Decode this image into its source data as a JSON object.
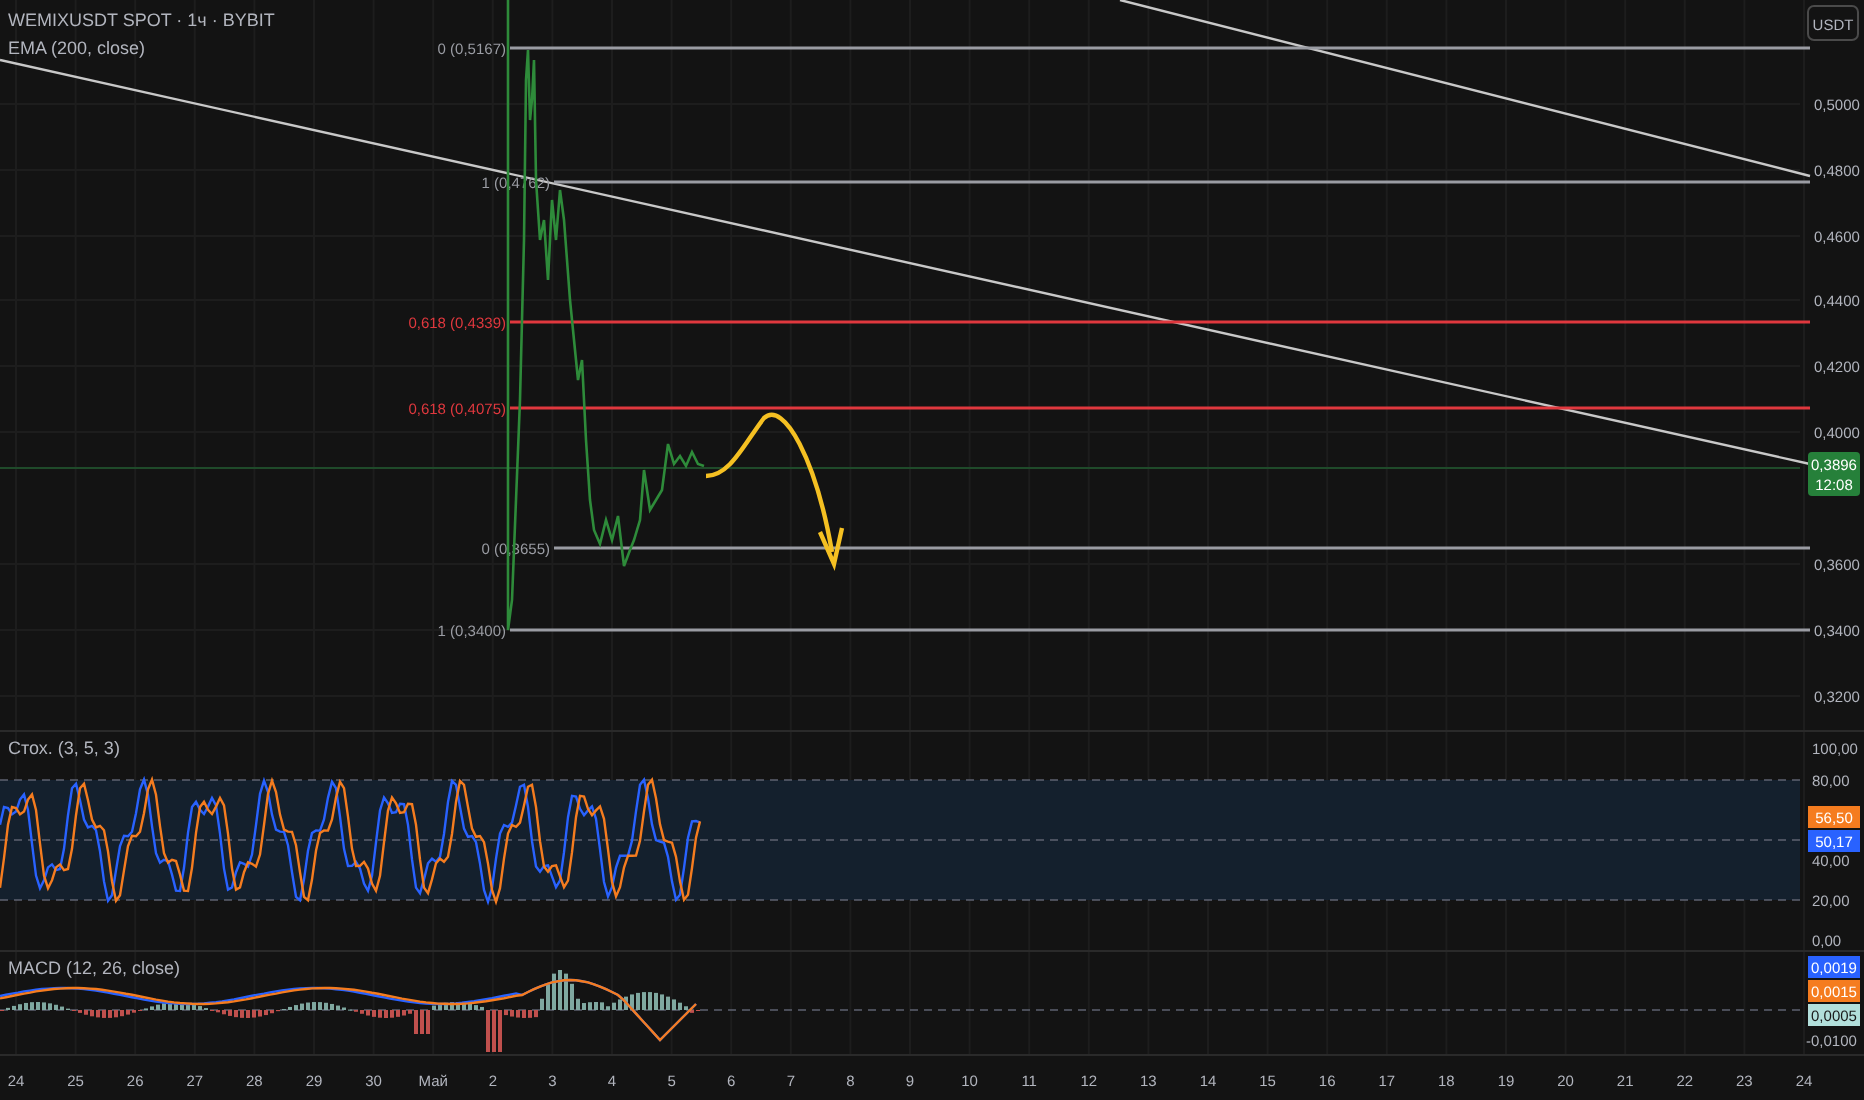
{
  "header": {
    "symbol": "WEMIXUSDT SPOT · 1ч · BYBIT",
    "indicator": "EMA (200, close)"
  },
  "price_axis": {
    "currency": "USDT",
    "ticks": [
      "0,5000",
      "0,4800",
      "0,4600",
      "0,4400",
      "0,4200",
      "0,4000",
      "0,3600",
      "0,3400",
      "0,3200"
    ],
    "last_price": {
      "value": "0,3896",
      "countdown": "12:08"
    }
  },
  "fib_levels": [
    {
      "label": "0 (0,5167)",
      "color": "#9a9ca3"
    },
    {
      "label": "1 (0,4762)",
      "color": "#9a9ca3"
    },
    {
      "label": "0,618 (0,4339)",
      "color": "#e0383e"
    },
    {
      "label": "0,618 (0,4075)",
      "color": "#e0383e"
    },
    {
      "label": "0 (0,3655)",
      "color": "#9a9ca3"
    },
    {
      "label": "1 (0,3400)",
      "color": "#9a9ca3"
    }
  ],
  "stochastic": {
    "title": "Стох. (3, 5, 3)",
    "ticks": [
      "100,00",
      "80,00",
      "40,00",
      "20,00",
      "0,00"
    ],
    "series": [
      {
        "value": "56,50",
        "color": "#f57c1f"
      },
      {
        "value": "50,17",
        "color": "#2962ff"
      }
    ]
  },
  "macd": {
    "title": "MACD (12, 26, close)",
    "tick": "-0,0100",
    "series": [
      {
        "value": "0,0019",
        "color": "#2962ff"
      },
      {
        "value": "0,0015",
        "color": "#f57c1f"
      },
      {
        "value": "0,0005",
        "color": "#b2dfdb"
      }
    ]
  },
  "time_axis": [
    "24",
    "25",
    "26",
    "27",
    "28",
    "29",
    "30",
    "Май",
    "2",
    "3",
    "4",
    "5",
    "6",
    "7",
    "8",
    "9",
    "10",
    "11",
    "12",
    "13",
    "14",
    "15",
    "16",
    "17",
    "18",
    "19",
    "20",
    "21",
    "22",
    "23",
    "24"
  ]
}
